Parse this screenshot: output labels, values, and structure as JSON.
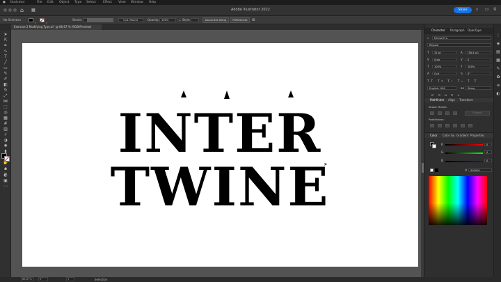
{
  "menubar": {
    "apple": "",
    "items": [
      "Illustrator",
      "File",
      "Edit",
      "Object",
      "Type",
      "Select",
      "Effect",
      "View",
      "Window",
      "Help"
    ]
  },
  "titlebar": {
    "title": "Adobe Illustrator 2022",
    "share_label": "Share"
  },
  "controlbar": {
    "selection_label": "No Selection",
    "stroke_label": "Stroke:",
    "brush_label": "5 pt. Round",
    "opacity_label": "Opacity:",
    "opacity_value": "100%",
    "style_label": "Style:",
    "doc_setup_label": "Document Setup",
    "preferences_label": "Preferences"
  },
  "document": {
    "tab_label": "Exercise 2 Modifying Type.ai* @ 66.67 % (RGB/Preview)",
    "artwork_line1": "INTER",
    "artwork_line2": "TWINE"
  },
  "panels": {
    "tabs": [
      "Character",
      "Paragraph",
      "OpenType"
    ],
    "font_family": "Mirinal Pro",
    "font_style": "Regular",
    "font_size": "32 pt",
    "leading": "(38.4 pt)",
    "kerning": "Auto",
    "tracking": "0",
    "horiz_scale": "100%",
    "vert_scale": "100%",
    "baseline": "0 pt",
    "rotation": "0°",
    "language": "English: USA",
    "aa": "Sharp",
    "pathfinder_tabs": [
      "Pathfinder",
      "Align",
      "Transform"
    ],
    "shape_modes_label": "Shape Modes:",
    "expand_label": "Expand",
    "pathfinders_label": "Pathfinders:",
    "color_tabs": [
      "Color",
      "Color Gu",
      "Gradient",
      "Properties"
    ],
    "r_label": "R",
    "g_label": "G",
    "b_label": "B",
    "r_value": "0",
    "g_value": "0",
    "b_value": "0",
    "hex_prefix": "#",
    "hex_value": "000000"
  },
  "statusbar": {
    "zoom": "66.67%",
    "rotate": "0°",
    "artboard": "1",
    "tool": "Selection"
  },
  "colors": {
    "accent": "#1473e6",
    "app_bg": "#2b2b2b",
    "canvas": "#535353",
    "artboard": "#ffffff"
  }
}
